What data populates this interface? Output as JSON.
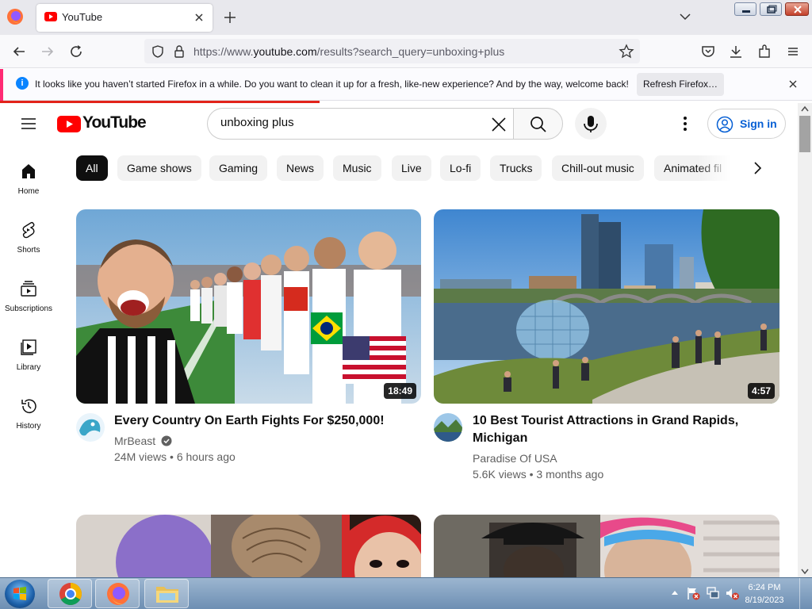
{
  "browser": {
    "tab_title": "YouTube",
    "url_prefix": "https://www.",
    "url_domain": "youtube.com",
    "url_path": "/results?search_query=unboxing+plus"
  },
  "notification": {
    "message": "It looks like you haven’t started Firefox in a while. Do you want to clean it up for a fresh, like-new experience? And by the way, welcome back!",
    "refresh_label": "Refresh Firefox…"
  },
  "youtube": {
    "logo_text": "YouTube",
    "search_value": "unboxing plus",
    "signin_label": "Sign in",
    "rail": [
      {
        "label": "Home",
        "icon": "home-icon"
      },
      {
        "label": "Shorts",
        "icon": "shorts-icon"
      },
      {
        "label": "Subscriptions",
        "icon": "subscriptions-icon"
      },
      {
        "label": "Library",
        "icon": "library-icon"
      },
      {
        "label": "History",
        "icon": "history-icon"
      }
    ],
    "chips": [
      "All",
      "Game shows",
      "Gaming",
      "News",
      "Music",
      "Live",
      "Lo-fi",
      "Trucks",
      "Chill-out music",
      "Animated fil"
    ],
    "videos": [
      {
        "title": "Every Country On Earth Fights For $250,000!",
        "channel": "MrBeast",
        "verified": true,
        "views": "24M views",
        "age": "6 hours ago",
        "duration": "18:49"
      },
      {
        "title": "10 Best Tourist Attractions in Grand Rapids, Michigan",
        "channel": "Paradise Of USA",
        "verified": false,
        "views": "5.6K views",
        "age": "3 months ago",
        "duration": "4:57"
      }
    ]
  },
  "taskbar": {
    "time": "6:24 PM",
    "date": "8/19/2023"
  },
  "colors": {
    "youtube_red": "#ff0000",
    "link_blue": "#065fd4",
    "firefox_accent": "#0a84ff"
  }
}
